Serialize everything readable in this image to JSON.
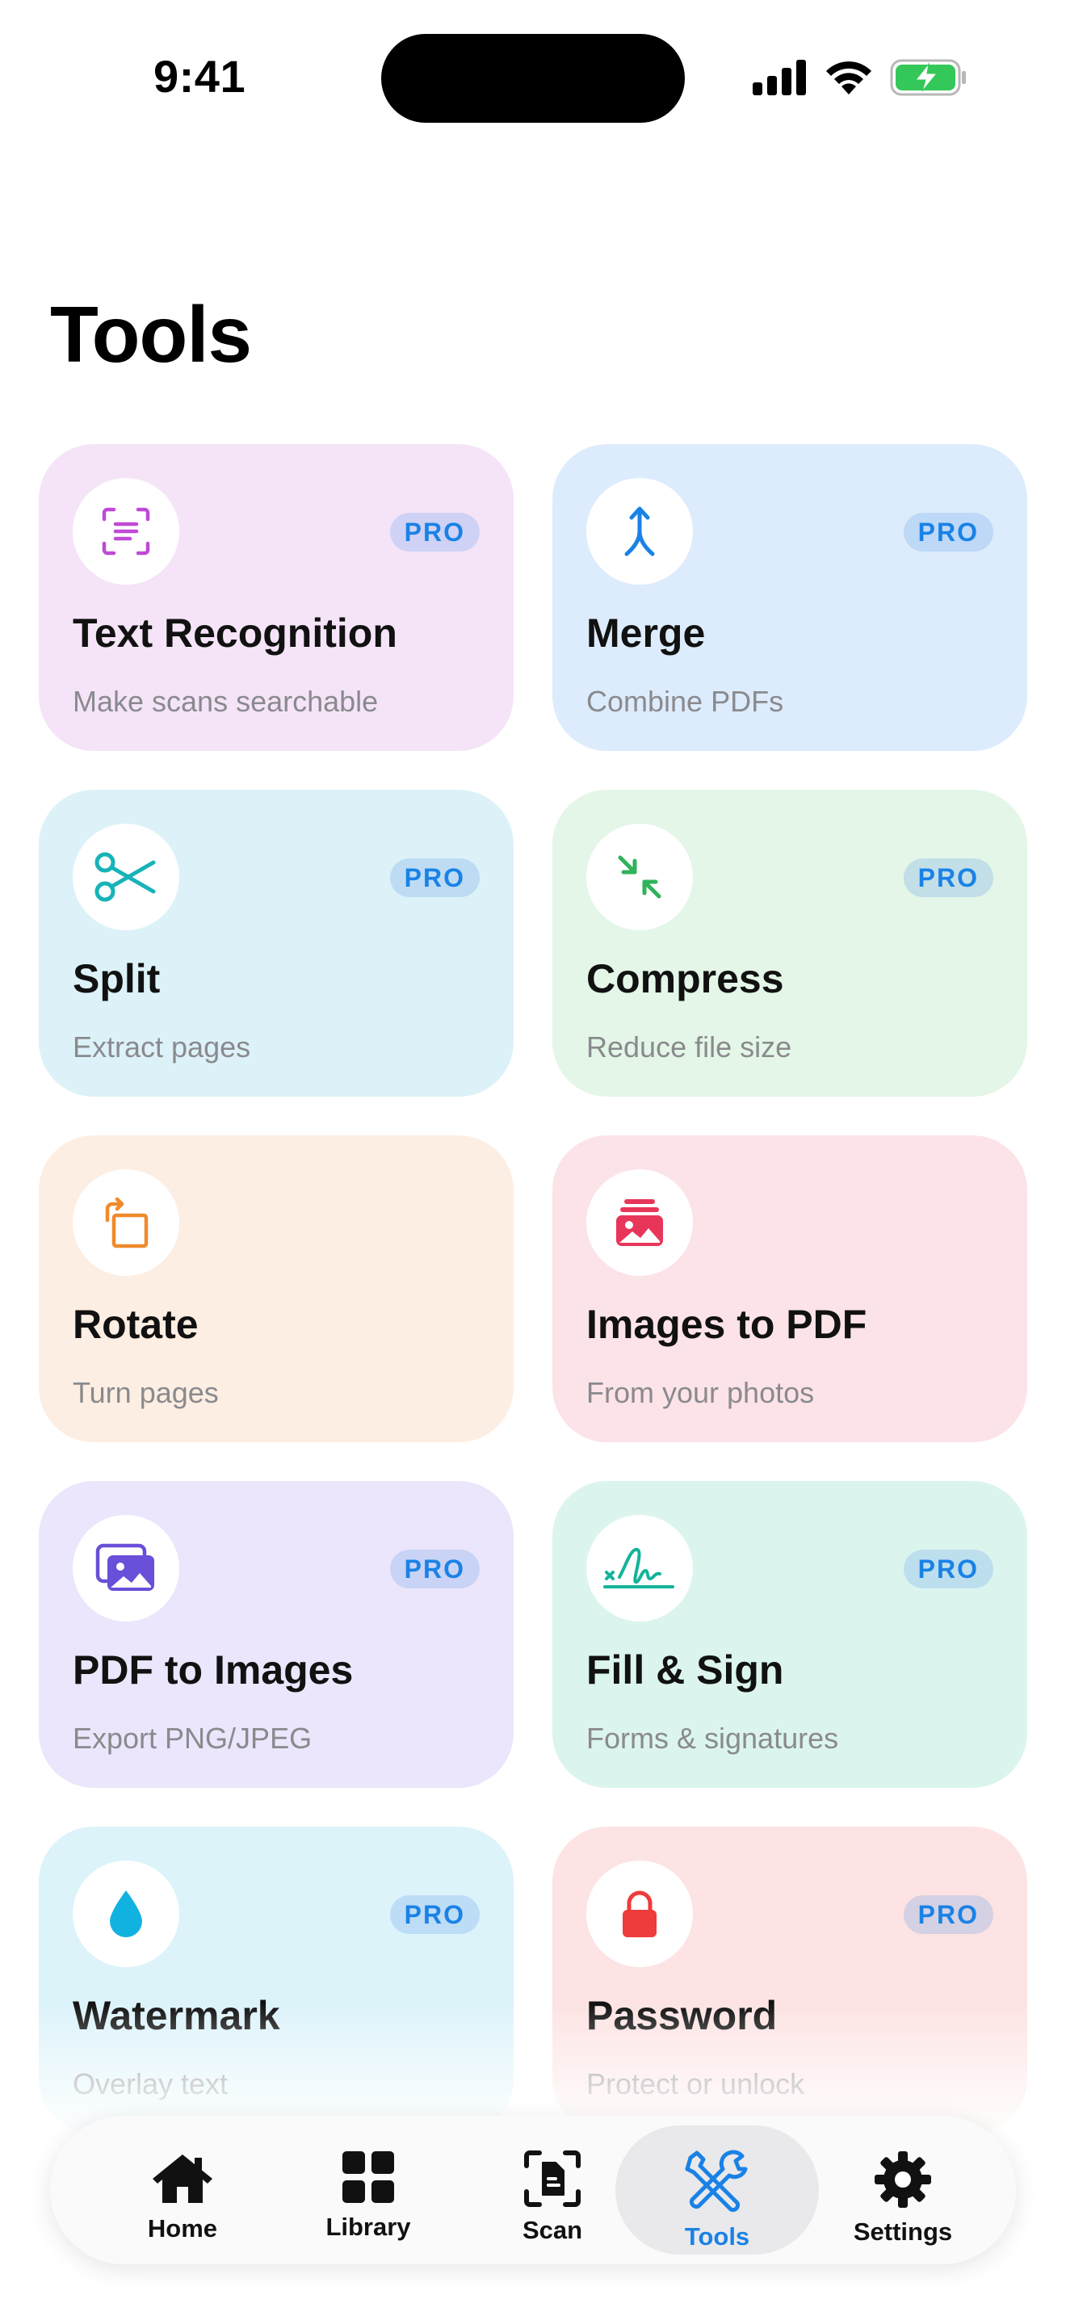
{
  "status_bar": {
    "time": "9:41",
    "icons": [
      "signal-icon",
      "wifi-icon",
      "battery-charging-icon"
    ],
    "battery_color": "#34c759"
  },
  "page_title": "Tools",
  "badge_label": "PRO",
  "tools": [
    {
      "title": "Text Recognition",
      "subtitle": "Make scans searchable",
      "icon": "text-recognition-icon",
      "bg": "#f5e4f8",
      "icon_color": "#c04ad6",
      "pro": true
    },
    {
      "title": "Merge",
      "subtitle": "Combine PDFs",
      "icon": "merge-icon",
      "bg": "#ddecfc",
      "icon_color": "#1a82e6",
      "pro": true
    },
    {
      "title": "Split",
      "subtitle": "Extract pages",
      "icon": "scissors-icon",
      "bg": "#dcf2f8",
      "icon_color": "#17b3b8",
      "pro": true
    },
    {
      "title": "Compress",
      "subtitle": "Reduce file size",
      "icon": "compress-icon",
      "bg": "#e3f6e7",
      "icon_color": "#2fb35b",
      "pro": true
    },
    {
      "title": "Rotate",
      "subtitle": "Turn pages",
      "icon": "rotate-icon",
      "bg": "#fdeee3",
      "icon_color": "#f08a2c",
      "pro": false
    },
    {
      "title": "Images to PDF",
      "subtitle": "From your photos",
      "icon": "photo-stack-icon",
      "bg": "#fce3e8",
      "icon_color": "#e8365a",
      "pro": false
    },
    {
      "title": "PDF to Images",
      "subtitle": "Export PNG/JPEG",
      "icon": "photos-icon",
      "bg": "#ebe6fb",
      "icon_color": "#6a4fd8",
      "pro": true
    },
    {
      "title": "Fill & Sign",
      "subtitle": "Forms & signatures",
      "icon": "signature-icon",
      "bg": "#dbf5ee",
      "icon_color": "#14b39a",
      "pro": true
    },
    {
      "title": "Watermark",
      "subtitle": "Overlay text",
      "icon": "drop-icon",
      "bg": "#dcf3fa",
      "icon_color": "#12b2e0",
      "pro": true
    },
    {
      "title": "Password",
      "subtitle": "Protect or unlock",
      "icon": "lock-icon",
      "bg": "#fde3e3",
      "icon_color": "#ef3b3b",
      "pro": true
    }
  ],
  "tab_bar": {
    "tabs": [
      {
        "label": "Home",
        "icon": "house-icon",
        "active": false
      },
      {
        "label": "Library",
        "icon": "grid-icon",
        "active": false
      },
      {
        "label": "Scan",
        "icon": "scan-document-icon",
        "active": false
      },
      {
        "label": "Tools",
        "icon": "tools-icon",
        "active": true
      },
      {
        "label": "Settings",
        "icon": "gear-icon",
        "active": false
      }
    ],
    "active_color": "#1a82e6"
  }
}
